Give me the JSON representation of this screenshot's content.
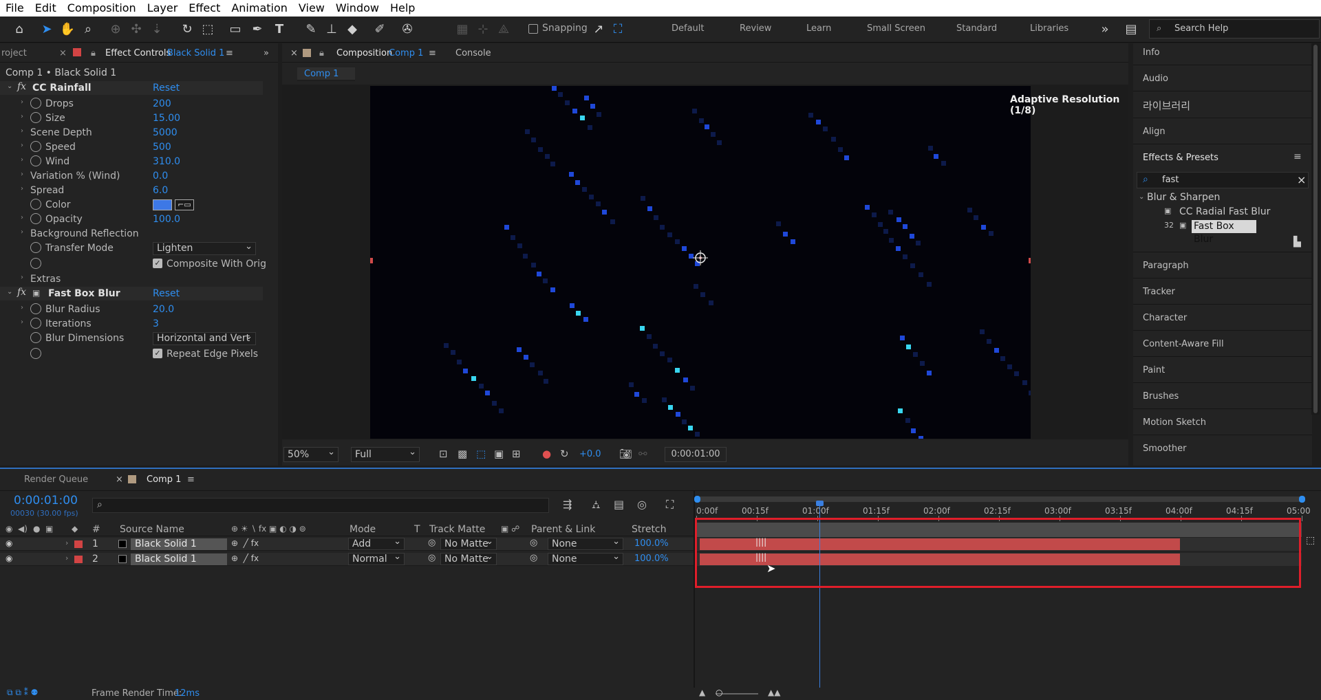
{
  "menu": [
    "File",
    "Edit",
    "Composition",
    "Layer",
    "Effect",
    "Animation",
    "View",
    "Window",
    "Help"
  ],
  "toolbar": {
    "snapping_label": "Snapping",
    "workspaces": [
      "Default",
      "Review",
      "Learn",
      "Small Screen",
      "Standard",
      "Libraries"
    ],
    "search_placeholder": "Search Help"
  },
  "left_panel": {
    "tab_project": "roject",
    "tab_effect_controls": "Effect Controls",
    "tab_layer": "Black Solid 1",
    "header": "Comp 1 • Black Solid 1",
    "effects": [
      {
        "name": "CC Rainfall",
        "reset": "Reset",
        "props": [
          {
            "name": "Drops",
            "value": "200"
          },
          {
            "name": "Size",
            "value": "15.00"
          },
          {
            "name": "Scene Depth",
            "value": "5000"
          },
          {
            "name": "Speed",
            "value": "500"
          },
          {
            "name": "Wind",
            "value": "310.0"
          },
          {
            "name": "Variation % (Wind)",
            "value": "0.0"
          },
          {
            "name": "Spread",
            "value": "6.0"
          },
          {
            "name": "Color",
            "value": ""
          },
          {
            "name": "Opacity",
            "value": "100.0"
          },
          {
            "name": "Background Reflection",
            "value": ""
          },
          {
            "name": "Transfer Mode",
            "value": "Lighten"
          },
          {
            "name": "",
            "value": "Composite With Orig"
          },
          {
            "name": "Extras",
            "value": ""
          }
        ]
      },
      {
        "name": "Fast Box Blur",
        "reset": "Reset",
        "props": [
          {
            "name": "Blur Radius",
            "value": "20.0"
          },
          {
            "name": "Iterations",
            "value": "3"
          },
          {
            "name": "Blur Dimensions",
            "value": "Horizontal and Vert"
          },
          {
            "name": "",
            "value": "Repeat Edge Pixels"
          }
        ]
      }
    ]
  },
  "comp_panel": {
    "tab_label": "Composition",
    "tab_comp": "Comp 1",
    "tab_console": "Console",
    "subtab": "Comp 1",
    "adaptive": "Adaptive Resolution (1/8)",
    "zoom": "50%",
    "quality": "Full",
    "exposure": "+0.0",
    "timecode": "0:00:01:00"
  },
  "right_panel": {
    "items_top": [
      "Info",
      "Audio",
      "라이브러리",
      "Align"
    ],
    "effects_presets_title": "Effects & Presets",
    "search_value": "fast",
    "category": "Blur & Sharpen",
    "results": [
      "CC Radial Fast Blur",
      "Fast Box Blur"
    ],
    "items_bottom": [
      "Paragraph",
      "Tracker",
      "Character",
      "Content-Aware Fill",
      "Paint",
      "Brushes",
      "Motion Sketch",
      "Smoother"
    ]
  },
  "timeline": {
    "tab_render_queue": "Render Queue",
    "tab_comp": "Comp 1",
    "timecode": "0:00:01:00",
    "fps": "00030 (30.00 fps)",
    "columns": {
      "hash": "#",
      "source": "Source Name",
      "mode": "Mode",
      "t": "T",
      "track_matte": "Track Matte",
      "parent": "Parent & Link",
      "stretch": "Stretch"
    },
    "layers": [
      {
        "num": "1",
        "name": "Black Solid 1",
        "mode": "Add",
        "matte": "No Matte",
        "parent": "None",
        "stretch": "100.0%"
      },
      {
        "num": "2",
        "name": "Black Solid 1",
        "mode": "Normal",
        "matte": "No Matte",
        "parent": "None",
        "stretch": "100.0%"
      }
    ],
    "ruler": [
      "0:00f",
      "00:15f",
      "01:00f",
      "01:15f",
      "02:00f",
      "02:15f",
      "03:00f",
      "03:15f",
      "04:00f",
      "04:15f",
      "05:00"
    ],
    "render_time_label": "Frame Render Time:",
    "render_time_value": "12ms"
  },
  "colors": {
    "accent": "#2f8ef0",
    "layer_bar": "#c24a4a",
    "label_red": "#d24444",
    "highlight_box": "#e01e2a"
  }
}
